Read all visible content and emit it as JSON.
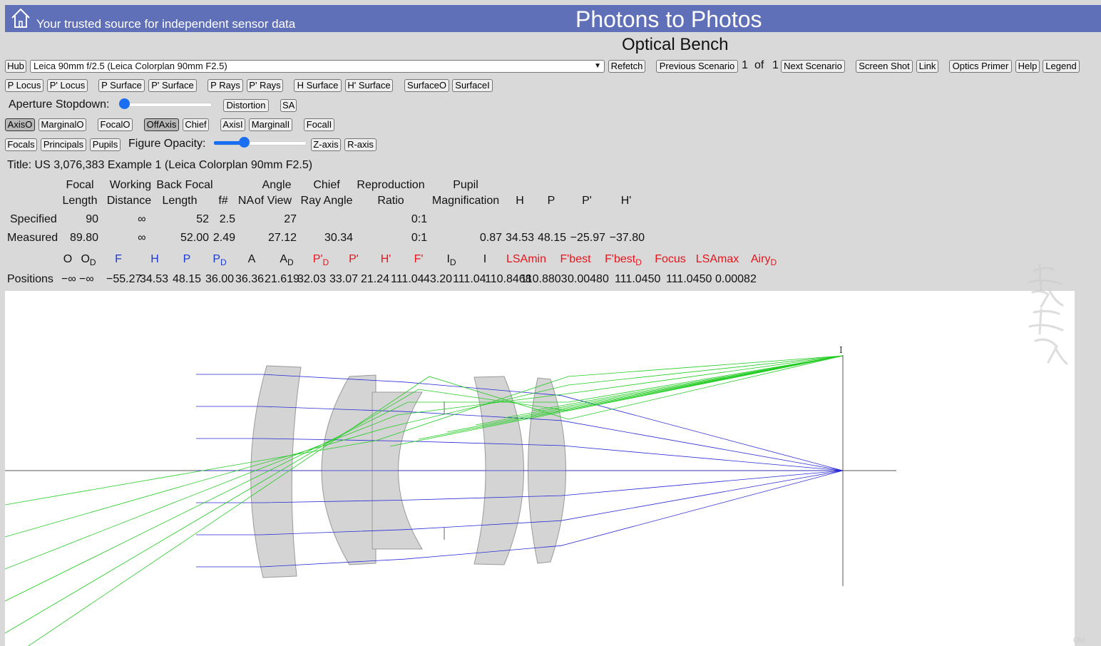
{
  "header": {
    "tagline": "Your trusted source for independent sensor data",
    "site_title": "Photons to Photos",
    "page_title": "Optical Bench",
    "bar_color": "#5f6fb8"
  },
  "controls": {
    "hub": "Hub",
    "lens_select": "Leica 90mm f/2.5 (Leica Colorplan 90mm F2.5)",
    "refetch": "Refetch",
    "previous_scenario": "Previous Scenario",
    "scenario_current": "1",
    "scenario_of": "of",
    "scenario_total": "1",
    "next_scenario": "Next Scenario",
    "screen_shot": "Screen Shot",
    "link": "Link",
    "optics_primer": "Optics Primer",
    "help": "Help",
    "legend": "Legend",
    "p_locus": "P Locus",
    "pp_locus": "P' Locus",
    "p_surface": "P Surface",
    "pp_surface": "P' Surface",
    "p_rays": "P Rays",
    "pp_rays": "P' Rays",
    "h_surface": "H Surface",
    "hp_surface": "H' Surface",
    "surface_o": "SurfaceO",
    "surface_i": "SurfaceI",
    "aperture_label": "Aperture Stopdown:",
    "aperture_value": 0,
    "distortion": "Distortion",
    "sa": "SA",
    "axis_o": "AxisO",
    "marginal_o": "MarginalO",
    "focal_o": "FocalO",
    "off_axis": "OffAxis",
    "chief": "Chief",
    "axis_i": "AxisI",
    "marginal_i": "MarginalI",
    "focal_i": "FocalI",
    "focals": "Focals",
    "principals": "Principals",
    "pupils": "Pupils",
    "opacity_label": "Figure Opacity:",
    "opacity_value": 0.3,
    "z_axis": "Z-axis",
    "r_axis": "R-axis"
  },
  "lens_title": "Title: US 3,076,383 Example 1 (Leica Colorplan 90mm F2.5)",
  "table": {
    "headers_top": {
      "focal": "Focal",
      "working": "Working",
      "back_focal": "Back Focal",
      "angle": "Angle",
      "chief": "Chief",
      "reproduction": "Reproduction",
      "pupil": "Pupil"
    },
    "headers_bottom": {
      "length1": "Length",
      "distance": "Distance",
      "length2": "Length",
      "fnum": "f#",
      "na": "NA",
      "of_view": "of View",
      "ray_angle": "Ray Angle",
      "ratio": "Ratio",
      "magnification": "Magnification",
      "h": "H",
      "p": "P",
      "pp": "P'",
      "hp": "H'"
    },
    "specified": {
      "label": "Specified",
      "focal": "90",
      "working": "∞",
      "back": "52",
      "fnum": "2.5",
      "angle": "27",
      "ratio": "0:1"
    },
    "measured": {
      "label": "Measured",
      "focal": "89.80",
      "working": "∞",
      "back": "52.00",
      "fnum": "2.49",
      "angle": "27.12",
      "chief": "30.34",
      "ratio": "0:1",
      "pupil_mag": "0.87",
      "h": "34.53",
      "p": "48.15",
      "pp": "−25.97",
      "hp": "−37.80"
    }
  },
  "positions": {
    "label": "Positions",
    "colors": {
      "black": "#111111",
      "blue": "#1a3ad6",
      "red": "#e8141c"
    },
    "items": [
      {
        "label": "O",
        "value": "−∞"
      },
      {
        "label": "O",
        "sub": "D",
        "value": "−∞"
      },
      {
        "label": "F",
        "value": "−55.27"
      },
      {
        "label": "H",
        "value": "34.53"
      },
      {
        "label": "P",
        "value": "48.15"
      },
      {
        "label": "P",
        "sub": "D",
        "value": "36.00"
      },
      {
        "label": "A",
        "value": "36.36"
      },
      {
        "label": "A",
        "sub": "D",
        "value": "21.619"
      },
      {
        "label": "P'",
        "sub": "D",
        "value": "32.03"
      },
      {
        "label": "P'",
        "value": "33.07"
      },
      {
        "label": "H'",
        "value": "21.24"
      },
      {
        "label": "F'",
        "value": "111.04"
      },
      {
        "label": "I",
        "sub": "D",
        "value": "43.20"
      },
      {
        "label": "I",
        "value": "111.04"
      },
      {
        "label": "LSAmin",
        "value": "110.8468"
      },
      {
        "label": "F'best",
        "value": "110.8803"
      },
      {
        "label": "F'best",
        "sub": "D",
        "value": "0.00480"
      },
      {
        "label": "Focus",
        "value": "111.0450"
      },
      {
        "label": "LSAmax",
        "value": "111.0450"
      },
      {
        "label": "Airy",
        "sub": "D",
        "value": "0.00082"
      }
    ]
  },
  "diagram": {
    "image_label": "I",
    "ray_colors": {
      "axial": "#2a2ad8",
      "off_axis": "#22cc22",
      "axis_line": "#555555"
    },
    "lens_fill": "#d4d4d4"
  },
  "footer": {
    "mark": "OM"
  }
}
